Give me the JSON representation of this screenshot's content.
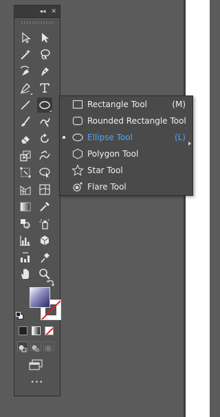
{
  "colors": {
    "canvas": "#5b5b5b",
    "panel": "#535353",
    "titlebar": "#3a3a3a",
    "flyout": "#4a4a4a",
    "icon": "#e6e6e6",
    "active_text": "#4ea4ff",
    "stroke_none": "#e02020"
  },
  "toolbar": {
    "titlebar": {
      "collapse_label": "◂◂",
      "close_label": "✕"
    },
    "tools": [
      {
        "name": "selection-tool",
        "icon": "arrow-outline-icon"
      },
      {
        "name": "direct-selection-tool",
        "icon": "arrow-filled-icon"
      },
      {
        "name": "magic-wand-tool",
        "icon": "magic-wand-icon"
      },
      {
        "name": "lasso-tool",
        "icon": "lasso-icon"
      },
      {
        "name": "curvature-tool",
        "icon": "curvature-pen-icon"
      },
      {
        "name": "pen-tool",
        "icon": "pen-icon"
      },
      {
        "name": "paintbrush-tool",
        "icon": "paintbrush-pen-icon"
      },
      {
        "name": "type-tool",
        "icon": "type-t-icon"
      },
      {
        "name": "line-tool",
        "icon": "line-segment-icon"
      },
      {
        "name": "ellipse-tool",
        "icon": "ellipse-icon",
        "selected": true
      },
      {
        "name": "brush-tool",
        "icon": "brush-icon"
      },
      {
        "name": "shaper-tool",
        "icon": "shaper-icon"
      },
      {
        "name": "eraser-tool",
        "icon": "eraser-icon"
      },
      {
        "name": "rotate-tool",
        "icon": "rotate-icon"
      },
      {
        "name": "scale-tool",
        "icon": "scale-icon"
      },
      {
        "name": "warp-tool",
        "icon": "warp-icon"
      },
      {
        "name": "free-transform-tool",
        "icon": "free-transform-icon"
      },
      {
        "name": "shape-builder-tool",
        "icon": "shape-builder-icon"
      },
      {
        "name": "perspective-grid-tool",
        "icon": "perspective-grid-icon"
      },
      {
        "name": "mesh-tool",
        "icon": "mesh-icon"
      },
      {
        "name": "gradient-tool",
        "icon": "gradient-icon"
      },
      {
        "name": "eyedropper-tool",
        "icon": "eyedropper-icon"
      },
      {
        "name": "blend-tool",
        "icon": "blend-icon"
      },
      {
        "name": "symbol-sprayer-tool",
        "icon": "symbol-sprayer-icon"
      },
      {
        "name": "column-graph-tool",
        "icon": "column-graph-icon"
      },
      {
        "name": "artboard-tool",
        "icon": "artboard-icon"
      },
      {
        "name": "slice-tool",
        "icon": "slice-icon"
      },
      {
        "name": "puppet-warp-tool",
        "icon": "pin-icon"
      },
      {
        "name": "hand-tool",
        "icon": "hand-icon"
      },
      {
        "name": "zoom-tool",
        "icon": "zoom-icon"
      }
    ],
    "more_label": "•••"
  },
  "flyout": {
    "items": [
      {
        "label": "Rectangle Tool",
        "key": "(M)",
        "icon": "rectangle-icon",
        "active": false
      },
      {
        "label": "Rounded Rectangle Tool",
        "key": "",
        "icon": "rounded-rectangle-icon",
        "active": false
      },
      {
        "label": "Ellipse Tool",
        "key": "(L)",
        "icon": "ellipse-icon",
        "active": true
      },
      {
        "label": "Polygon Tool",
        "key": "",
        "icon": "polygon-icon",
        "active": false
      },
      {
        "label": "Star Tool",
        "key": "",
        "icon": "star-icon",
        "active": false
      },
      {
        "label": "Flare Tool",
        "key": "",
        "icon": "flare-icon",
        "active": false
      }
    ]
  }
}
